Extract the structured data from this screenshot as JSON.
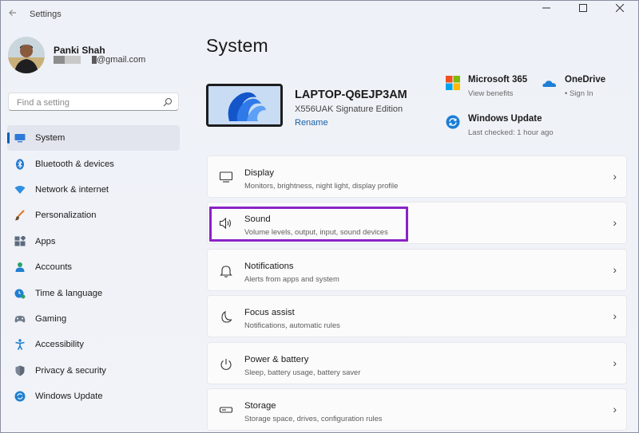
{
  "window": {
    "title": "Settings",
    "back_icon": "back-arrow-icon",
    "minimize_glyph": "—",
    "maximize_glyph": "☐",
    "close_glyph": "✕"
  },
  "profile": {
    "name": "Panki Shah",
    "email_domain": "@gmail.com"
  },
  "search": {
    "placeholder": "Find a setting"
  },
  "sidebar": {
    "items": [
      {
        "label": "System",
        "icon": "system-icon",
        "active": true
      },
      {
        "label": "Bluetooth & devices",
        "icon": "bluetooth-icon"
      },
      {
        "label": "Network & internet",
        "icon": "network-icon"
      },
      {
        "label": "Personalization",
        "icon": "personalization-icon"
      },
      {
        "label": "Apps",
        "icon": "apps-icon"
      },
      {
        "label": "Accounts",
        "icon": "accounts-icon"
      },
      {
        "label": "Time & language",
        "icon": "time-language-icon"
      },
      {
        "label": "Gaming",
        "icon": "gaming-icon"
      },
      {
        "label": "Accessibility",
        "icon": "accessibility-icon"
      },
      {
        "label": "Privacy & security",
        "icon": "privacy-icon"
      },
      {
        "label": "Windows Update",
        "icon": "windows-update-icon"
      }
    ]
  },
  "main": {
    "title": "System",
    "device": {
      "name": "LAPTOP-Q6EJP3AM",
      "model": "X556UAK Signature Edition",
      "rename": "Rename"
    },
    "quick": [
      {
        "title": "Microsoft 365",
        "subtitle": "View benefits",
        "icon": "microsoft-365-icon"
      },
      {
        "title": "OneDrive",
        "subtitle": "• Sign In",
        "icon": "onedrive-icon"
      },
      {
        "title": "Windows Update",
        "subtitle": "Last checked: 1 hour ago",
        "icon": "windows-update-icon"
      }
    ],
    "cards": [
      {
        "title": "Display",
        "subtitle": "Monitors, brightness, night light, display profile",
        "icon": "display-icon"
      },
      {
        "title": "Sound",
        "subtitle": "Volume levels, output, input, sound devices",
        "icon": "sound-icon",
        "highlighted": true
      },
      {
        "title": "Notifications",
        "subtitle": "Alerts from apps and system",
        "icon": "notifications-icon"
      },
      {
        "title": "Focus assist",
        "subtitle": "Notifications, automatic rules",
        "icon": "focus-assist-icon"
      },
      {
        "title": "Power & battery",
        "subtitle": "Sleep, battery usage, battery saver",
        "icon": "power-icon"
      },
      {
        "title": "Storage",
        "subtitle": "Storage space, drives, configuration rules",
        "icon": "storage-icon"
      }
    ],
    "chevron": "›"
  },
  "colors": {
    "accent": "#005fb8",
    "highlight_box": "#8a22c6",
    "link": "#1a5fa6"
  }
}
